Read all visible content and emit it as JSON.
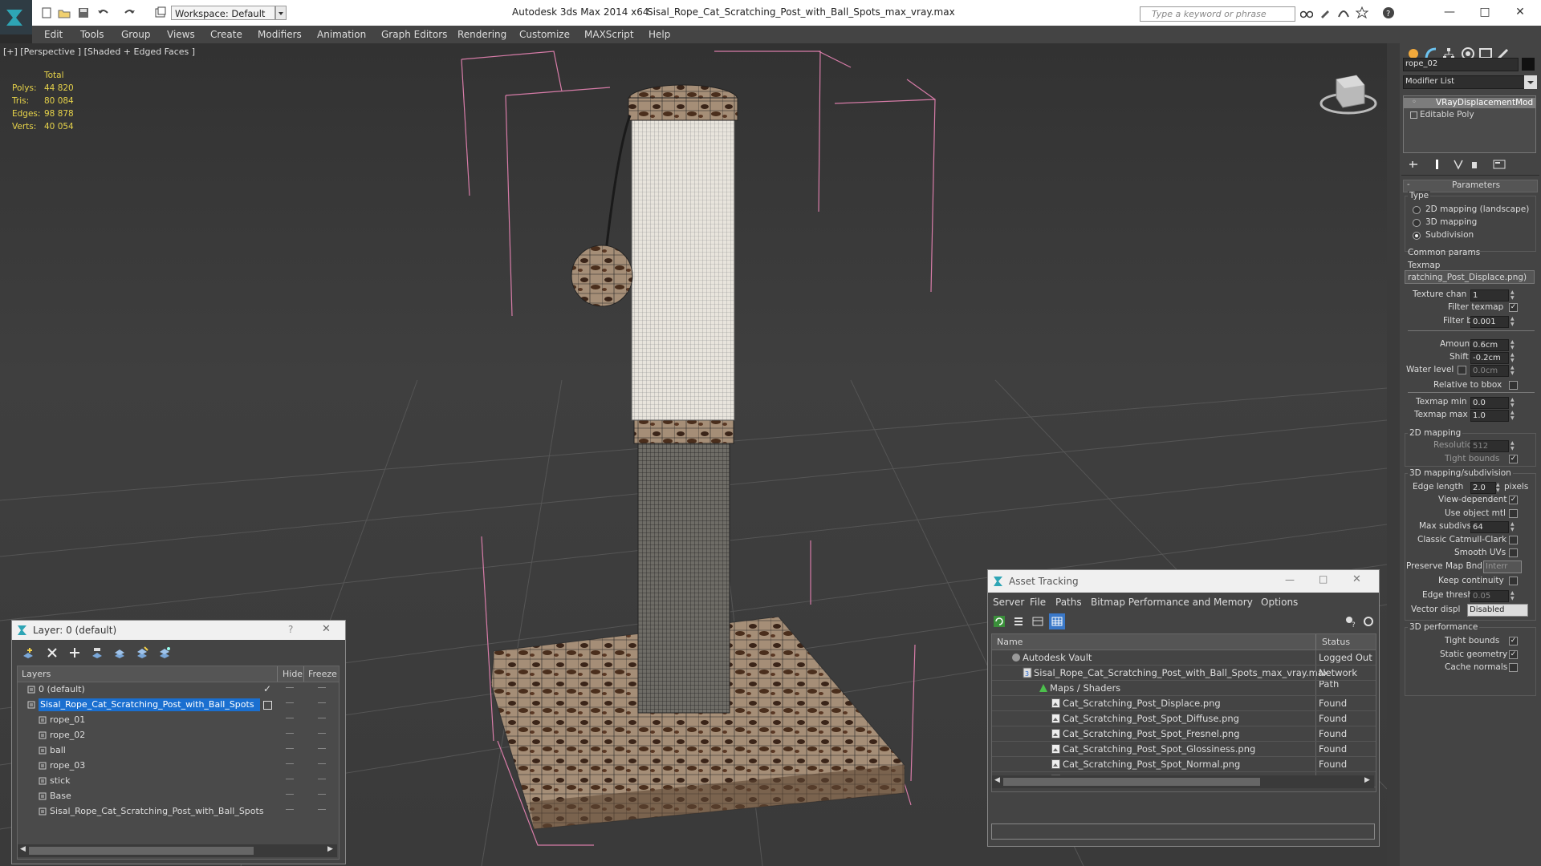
{
  "window": {
    "app_title": "Autodesk 3ds Max  2014 x64",
    "doc_title": "Sisal_Rope_Cat_Scratching_Post_with_Ball_Spots_max_vray.max",
    "workspace": "Workspace: Default",
    "search_placeholder": "Type a keyword or phrase"
  },
  "menu": [
    "Edit",
    "Tools",
    "Group",
    "Views",
    "Create",
    "Modifiers",
    "Animation",
    "Graph Editors",
    "Rendering",
    "Customize",
    "MAXScript",
    "Help"
  ],
  "viewport": {
    "label": "[+] [Perspective ] [Shaded + Edged Faces ]",
    "stats_header": "Total",
    "stats": [
      {
        "label": "Polys:",
        "value": "44 820"
      },
      {
        "label": "Tris:",
        "value": "80 084"
      },
      {
        "label": "Edges:",
        "value": "98 878"
      },
      {
        "label": "Verts:",
        "value": "40 054"
      }
    ]
  },
  "command_panel": {
    "object_name": "rope_02",
    "modifier_list": "Modifier List",
    "stack": [
      "VRayDisplacementMod",
      "Editable Poly"
    ],
    "rollout_title": "Parameters",
    "type_label": "Type",
    "type_options": [
      "2D mapping (landscape)",
      "3D mapping",
      "Subdivision"
    ],
    "type_selected": "Subdivision",
    "common_params": "Common params",
    "texmap_label": "Texmap",
    "texmap_value": "ratching_Post_Displace.png)",
    "texture_chan_label": "Texture chan",
    "texture_chan": "1",
    "filter_texmap": "Filter texmap",
    "filter_blur_label": "Filter blur",
    "filter_blur": "0.001",
    "amount_label": "Amount",
    "amount": "0.6cm",
    "shift_label": "Shift",
    "shift": "-0.2cm",
    "water_level_label": "Water level",
    "water_level": "0.0cm",
    "relative_bbox": "Relative to bbox",
    "texmap_min_label": "Texmap min",
    "texmap_min": "0.0",
    "texmap_max_label": "Texmap max",
    "texmap_max": "1.0",
    "mapping2d": "2D mapping",
    "resolution_label": "Resolution",
    "resolution": "512",
    "tight_bounds": "Tight bounds",
    "mapping3d": "3D mapping/subdivision",
    "edge_length_label": "Edge length",
    "edge_length": "2.0",
    "pixels": "pixels",
    "view_dependent": "View-dependent",
    "use_object_mtl": "Use object mtl",
    "max_subdivs_label": "Max subdivs",
    "max_subdivs": "64",
    "classic_catmull": "Classic Catmull-Clark",
    "smooth_uvs": "Smooth UVs",
    "preserve_map_bnd": "Preserve Map Bnd",
    "preserve_value": "Interr",
    "keep_continuity": "Keep continuity",
    "edge_thresh_label": "Edge thresh",
    "edge_thresh": "0.05",
    "vector_displ_label": "Vector displ",
    "vector_displ": "Disabled",
    "performance": "3D performance",
    "tight_bounds2": "Tight bounds",
    "static_geometry": "Static geometry",
    "cache_normals": "Cache normals"
  },
  "layer_dialog": {
    "title": "Layer: 0 (default)",
    "help": "?",
    "col_layers": "Layers",
    "col_hide": "Hide",
    "col_freeze": "Freeze",
    "rows": [
      {
        "name": "0 (default)",
        "indent": 0
      },
      {
        "name": "Sisal_Rope_Cat_Scratching_Post_with_Ball_Spots",
        "indent": 0
      },
      {
        "name": "rope_01",
        "indent": 1
      },
      {
        "name": "rope_02",
        "indent": 1
      },
      {
        "name": "ball",
        "indent": 1
      },
      {
        "name": "rope_03",
        "indent": 1
      },
      {
        "name": "stick",
        "indent": 1
      },
      {
        "name": "Base",
        "indent": 1
      },
      {
        "name": "Sisal_Rope_Cat_Scratching_Post_with_Ball_Spots",
        "indent": 1
      }
    ]
  },
  "asset_dialog": {
    "title": "Asset Tracking",
    "menu": [
      "Server",
      "File",
      "Paths",
      "Bitmap Performance and Memory",
      "Options"
    ],
    "col_name": "Name",
    "col_status": "Status",
    "rows": [
      {
        "name": "Autodesk Vault",
        "status": "Logged Out .",
        "level": 0
      },
      {
        "name": "Sisal_Rope_Cat_Scratching_Post_with_Ball_Spots_max_vray.max",
        "status": "Network Path",
        "level": 1
      },
      {
        "name": "Maps / Shaders",
        "status": "",
        "level": 2
      },
      {
        "name": "Cat_Scratching_Post_Displace.png",
        "status": "Found",
        "level": 3
      },
      {
        "name": "Cat_Scratching_Post_Spot_Diffuse.png",
        "status": "Found",
        "level": 3
      },
      {
        "name": "Cat_Scratching_Post_Spot_Fresnel.png",
        "status": "Found",
        "level": 3
      },
      {
        "name": "Cat_Scratching_Post_Spot_Glossiness.png",
        "status": "Found",
        "level": 3
      },
      {
        "name": "Cat_Scratching_Post_Spot_Normal.png",
        "status": "Found",
        "level": 3
      },
      {
        "name": "Cat_Scratching_Post_Spot_Specular.png",
        "status": "Found",
        "level": 3
      }
    ]
  }
}
